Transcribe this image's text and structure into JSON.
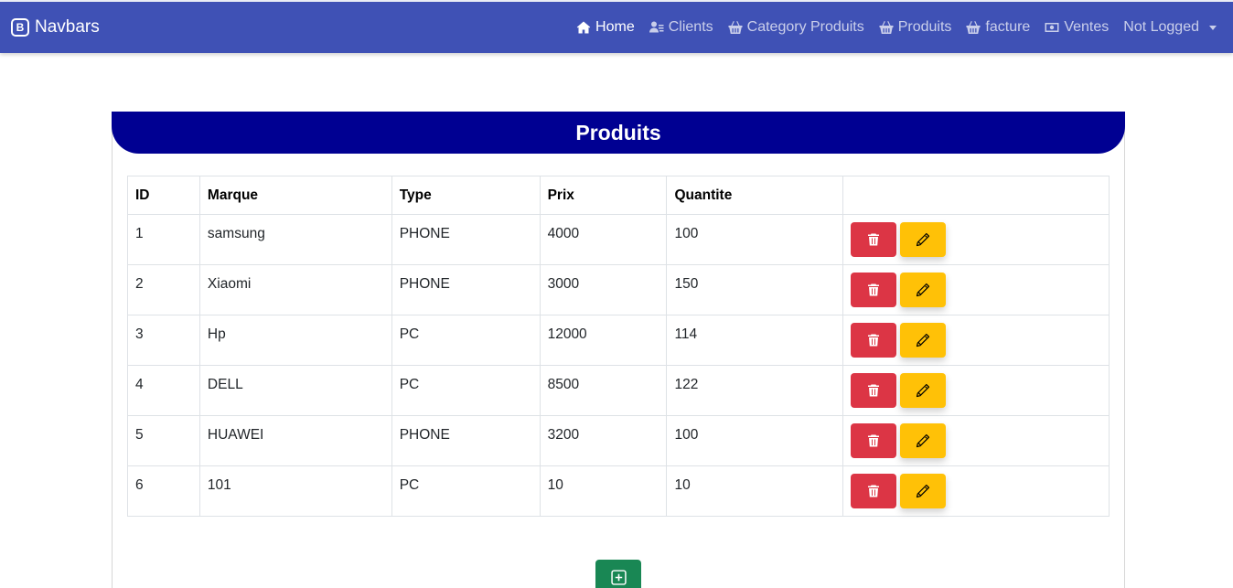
{
  "navbar": {
    "brand_icon": "B",
    "brand": "Navbars",
    "items": [
      {
        "label": "Home",
        "icon": "house-icon",
        "active": true
      },
      {
        "label": "Clients",
        "icon": "users-icon",
        "active": false
      },
      {
        "label": "Category Produits",
        "icon": "basket-icon",
        "active": false
      },
      {
        "label": "Produits",
        "icon": "basket-icon",
        "active": false
      },
      {
        "label": "facture",
        "icon": "basket-icon",
        "active": false
      },
      {
        "label": "Ventes",
        "icon": "cash-icon",
        "active": false
      }
    ],
    "account_label": "Not Logged"
  },
  "card": {
    "title": "Produits"
  },
  "table": {
    "headers": [
      "ID",
      "Marque",
      "Type",
      "Prix",
      "Quantite",
      ""
    ],
    "rows": [
      [
        "1",
        "samsung",
        "PHONE",
        "4000",
        "100"
      ],
      [
        "2",
        "Xiaomi",
        "PHONE",
        "3000",
        "150"
      ],
      [
        "3",
        "Hp",
        "PC",
        "12000",
        "114"
      ],
      [
        "4",
        "DELL",
        "PC",
        "8500",
        "122"
      ],
      [
        "5",
        "HUAWEI",
        "PHONE",
        "3200",
        "100"
      ],
      [
        "6",
        "101",
        "PC",
        "10",
        "10"
      ]
    ]
  },
  "colors": {
    "navbar": "#3f51b5",
    "card_header": "#000092",
    "delete": "#dc3545",
    "edit": "#ffc107",
    "add": "#198754"
  }
}
